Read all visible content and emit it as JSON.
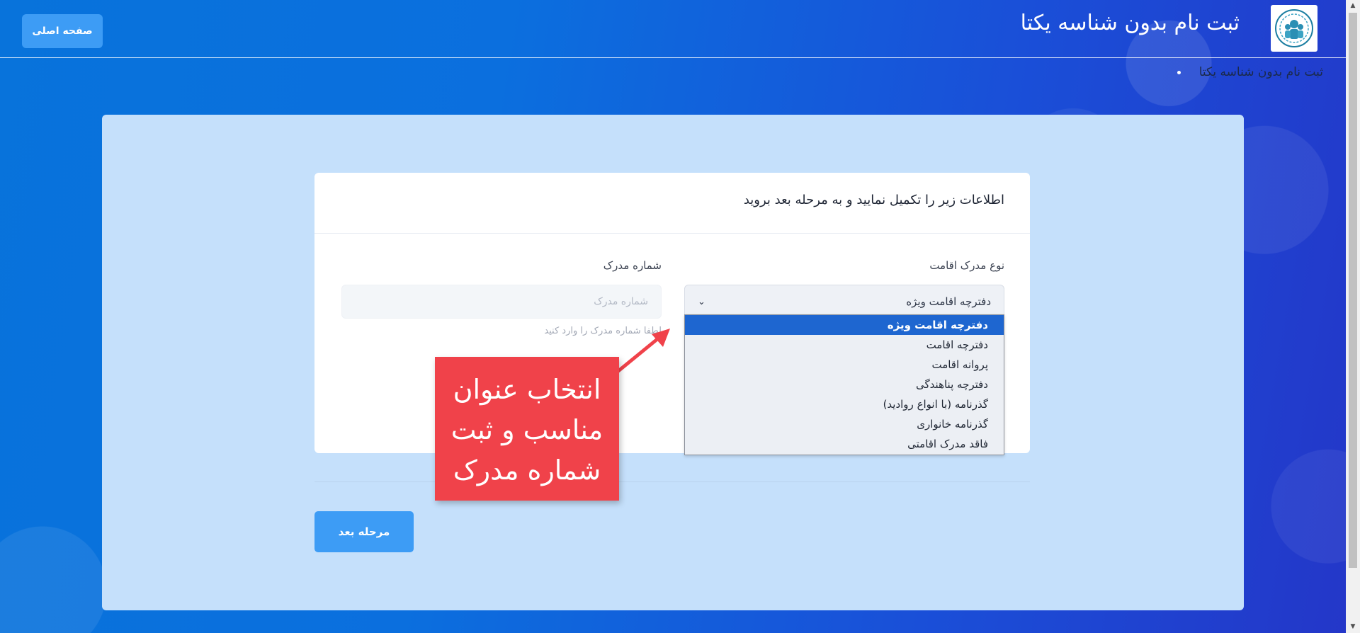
{
  "header": {
    "home_button": "صفحه اصلی",
    "site_title": "ثبت نام بدون شناسه یکتا"
  },
  "breadcrumb": {
    "current": "ثبت نام بدون شناسه یکتا"
  },
  "form": {
    "heading": "اطلاعات زیر را تکمیل نمایید و به مرحله بعد بروید",
    "document_type_label": "نوع مدرک اقامت",
    "document_type_selected": "دفترچه اقامت ویژه",
    "document_number_label": "شماره مدرک",
    "document_number_placeholder": "شماره مدرک",
    "document_number_value": "",
    "document_number_hint": "لطفا شماره مدرک را وارد کنید",
    "next_button": "مرحله بعد"
  },
  "dropdown": {
    "options": [
      "دفترچه اقامت ویژه",
      "دفترچه اقامت",
      "پروانه اقامت",
      "دفترچه پناهندگی",
      "گذرنامه (با انواع روادید)",
      "گذرنامه خانواری",
      "فاقد مدرک اقامتی"
    ],
    "selected_index": 0
  },
  "annotation": {
    "line1": "انتخاب عنوان",
    "line2": "مناسب و ثبت",
    "line3": "شماره مدرک"
  },
  "colors": {
    "accent_button": "#3d9cf5",
    "selected_option": "#1e66d0",
    "callout": "#f0424a",
    "panel": "#c5e0fb"
  }
}
